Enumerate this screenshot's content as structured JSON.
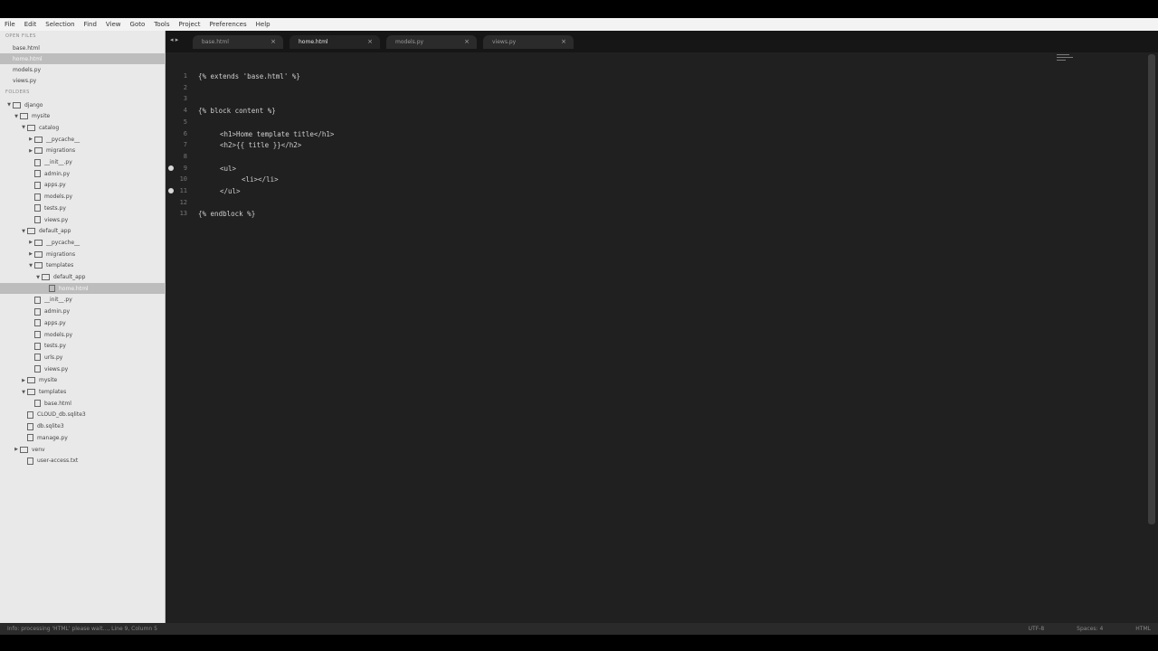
{
  "menu": [
    "File",
    "Edit",
    "Selection",
    "Find",
    "View",
    "Goto",
    "Tools",
    "Project",
    "Preferences",
    "Help"
  ],
  "sidebar": {
    "open_files_heading": "OPEN FILES",
    "open_files": [
      {
        "label": "base.html",
        "selected": false
      },
      {
        "label": "home.html",
        "selected": true
      },
      {
        "label": "models.py",
        "selected": false
      },
      {
        "label": "views.py",
        "selected": false
      }
    ],
    "folders_heading": "FOLDERS",
    "tree": [
      {
        "label": "django",
        "type": "folder",
        "depth": 0,
        "expanded": true
      },
      {
        "label": "mysite",
        "type": "folder",
        "depth": 1,
        "expanded": true
      },
      {
        "label": "catalog",
        "type": "folder",
        "depth": 2,
        "expanded": true
      },
      {
        "label": "__pycache__",
        "type": "folder",
        "depth": 3,
        "expanded": false
      },
      {
        "label": "migrations",
        "type": "folder",
        "depth": 3,
        "expanded": false
      },
      {
        "label": "__init__.py",
        "type": "file",
        "depth": 3
      },
      {
        "label": "admin.py",
        "type": "file",
        "depth": 3
      },
      {
        "label": "apps.py",
        "type": "file",
        "depth": 3
      },
      {
        "label": "models.py",
        "type": "file",
        "depth": 3
      },
      {
        "label": "tests.py",
        "type": "file",
        "depth": 3
      },
      {
        "label": "views.py",
        "type": "file",
        "depth": 3
      },
      {
        "label": "default_app",
        "type": "folder",
        "depth": 2,
        "expanded": true
      },
      {
        "label": "__pycache__",
        "type": "folder",
        "depth": 3,
        "expanded": false
      },
      {
        "label": "migrations",
        "type": "folder",
        "depth": 3,
        "expanded": false
      },
      {
        "label": "templates",
        "type": "folder",
        "depth": 3,
        "expanded": true
      },
      {
        "label": "default_app",
        "type": "folder",
        "depth": 4,
        "expanded": true
      },
      {
        "label": "home.html",
        "type": "file",
        "depth": 5,
        "selected": true
      },
      {
        "label": "__init__.py",
        "type": "file",
        "depth": 3
      },
      {
        "label": "admin.py",
        "type": "file",
        "depth": 3
      },
      {
        "label": "apps.py",
        "type": "file",
        "depth": 3
      },
      {
        "label": "models.py",
        "type": "file",
        "depth": 3
      },
      {
        "label": "tests.py",
        "type": "file",
        "depth": 3
      },
      {
        "label": "urls.py",
        "type": "file",
        "depth": 3
      },
      {
        "label": "views.py",
        "type": "file",
        "depth": 3
      },
      {
        "label": "mysite",
        "type": "folder",
        "depth": 2,
        "expanded": false
      },
      {
        "label": "templates",
        "type": "folder",
        "depth": 2,
        "expanded": true
      },
      {
        "label": "base.html",
        "type": "file",
        "depth": 3
      },
      {
        "label": "CLOUD_db.sqlite3",
        "type": "file",
        "depth": 2
      },
      {
        "label": "db.sqlite3",
        "type": "file",
        "depth": 2
      },
      {
        "label": "manage.py",
        "type": "file",
        "depth": 2
      },
      {
        "label": "venv",
        "type": "folder",
        "depth": 1,
        "expanded": false
      },
      {
        "label": "user-access.txt",
        "type": "file",
        "depth": 2
      }
    ]
  },
  "tabs": [
    {
      "label": "base.html",
      "active": false
    },
    {
      "label": "home.html",
      "active": true
    },
    {
      "label": "models.py",
      "active": false
    },
    {
      "label": "views.py",
      "active": false
    }
  ],
  "editor": {
    "lines": [
      {
        "n": "1",
        "text": "{% extends 'base.html' %}",
        "indent": 0
      },
      {
        "n": "2",
        "text": "",
        "indent": 0
      },
      {
        "n": "3",
        "text": "",
        "indent": 0
      },
      {
        "n": "4",
        "text": "{% block content %}",
        "indent": 0
      },
      {
        "n": "5",
        "text": "",
        "indent": 0
      },
      {
        "n": "6",
        "text": "<h1>Home template title</h1>",
        "indent": 1
      },
      {
        "n": "7",
        "text": "<h2>{{ title }}</h2>",
        "indent": 1
      },
      {
        "n": "8",
        "text": "",
        "indent": 0
      },
      {
        "n": "9",
        "text": "<ul>",
        "indent": 1,
        "bookmark": true
      },
      {
        "n": "10",
        "text": "<li></li>",
        "indent": 2
      },
      {
        "n": "11",
        "text": "</ul>",
        "indent": 1,
        "bookmark": true
      },
      {
        "n": "12",
        "text": "",
        "indent": 0
      },
      {
        "n": "13",
        "text": "{% endblock %}",
        "indent": 0
      }
    ]
  },
  "statusbar": {
    "left": "Info: processing 'HTML' please wait..., Line 9, Column 5",
    "encoding": "UTF-8",
    "spaces": "Spaces: 4",
    "syntax": "HTML"
  }
}
